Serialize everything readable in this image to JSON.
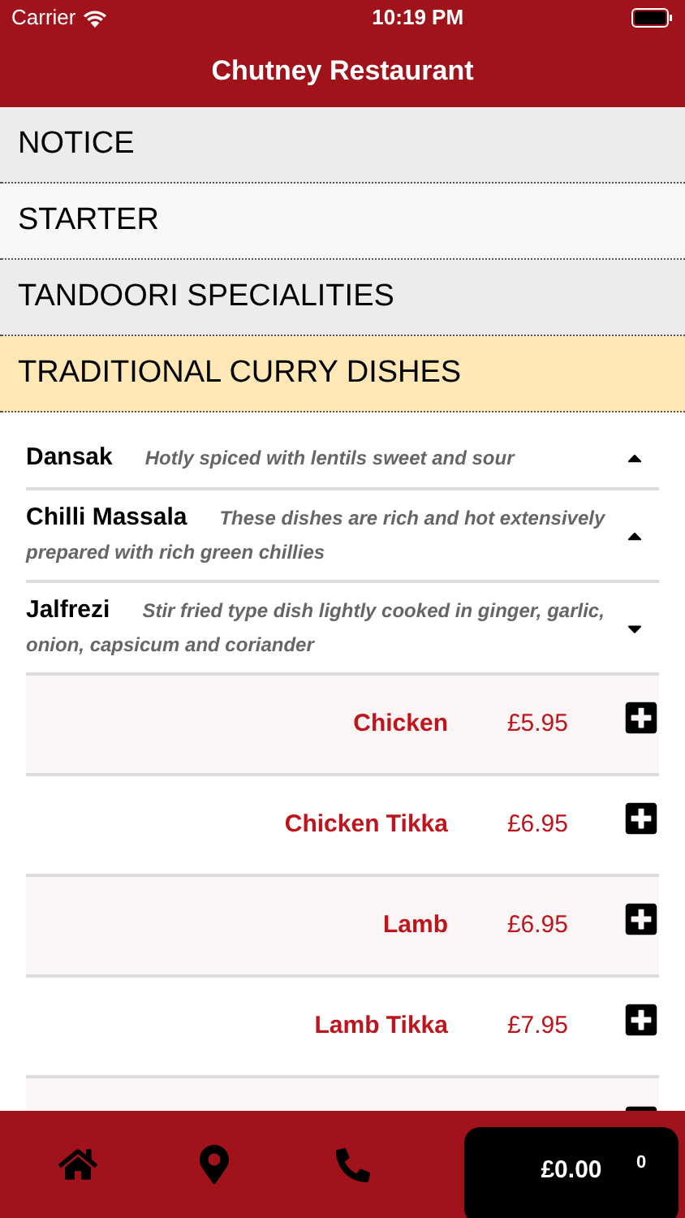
{
  "status_bar": {
    "carrier": "Carrier",
    "time": "10:19 PM"
  },
  "header": {
    "title": "Chutney Restaurant"
  },
  "categories": [
    {
      "label": "NOTICE",
      "selected": false
    },
    {
      "label": "STARTER",
      "selected": false
    },
    {
      "label": "TANDOORI SPECIALITIES",
      "selected": false
    },
    {
      "label": "TRADITIONAL CURRY DISHES",
      "selected": true
    }
  ],
  "dishes": [
    {
      "name": "Dansak",
      "description": "Hotly spiced with lentils sweet and sour",
      "expanded": false
    },
    {
      "name": "Chilli Massala",
      "description": "These dishes are rich and hot extensively prepared with rich green chillies",
      "expanded": false
    },
    {
      "name": "Jalfrezi",
      "description": "Stir fried type dish lightly cooked in ginger, garlic, onion, capsicum and coriander",
      "expanded": true
    }
  ],
  "items": [
    {
      "name": "Chicken",
      "price": "£5.95"
    },
    {
      "name": "Chicken Tikka",
      "price": "£6.95"
    },
    {
      "name": "Lamb",
      "price": "£6.95"
    },
    {
      "name": "Lamb Tikka",
      "price": "£7.95"
    }
  ],
  "cart": {
    "total": "£0.00",
    "count": "0"
  }
}
